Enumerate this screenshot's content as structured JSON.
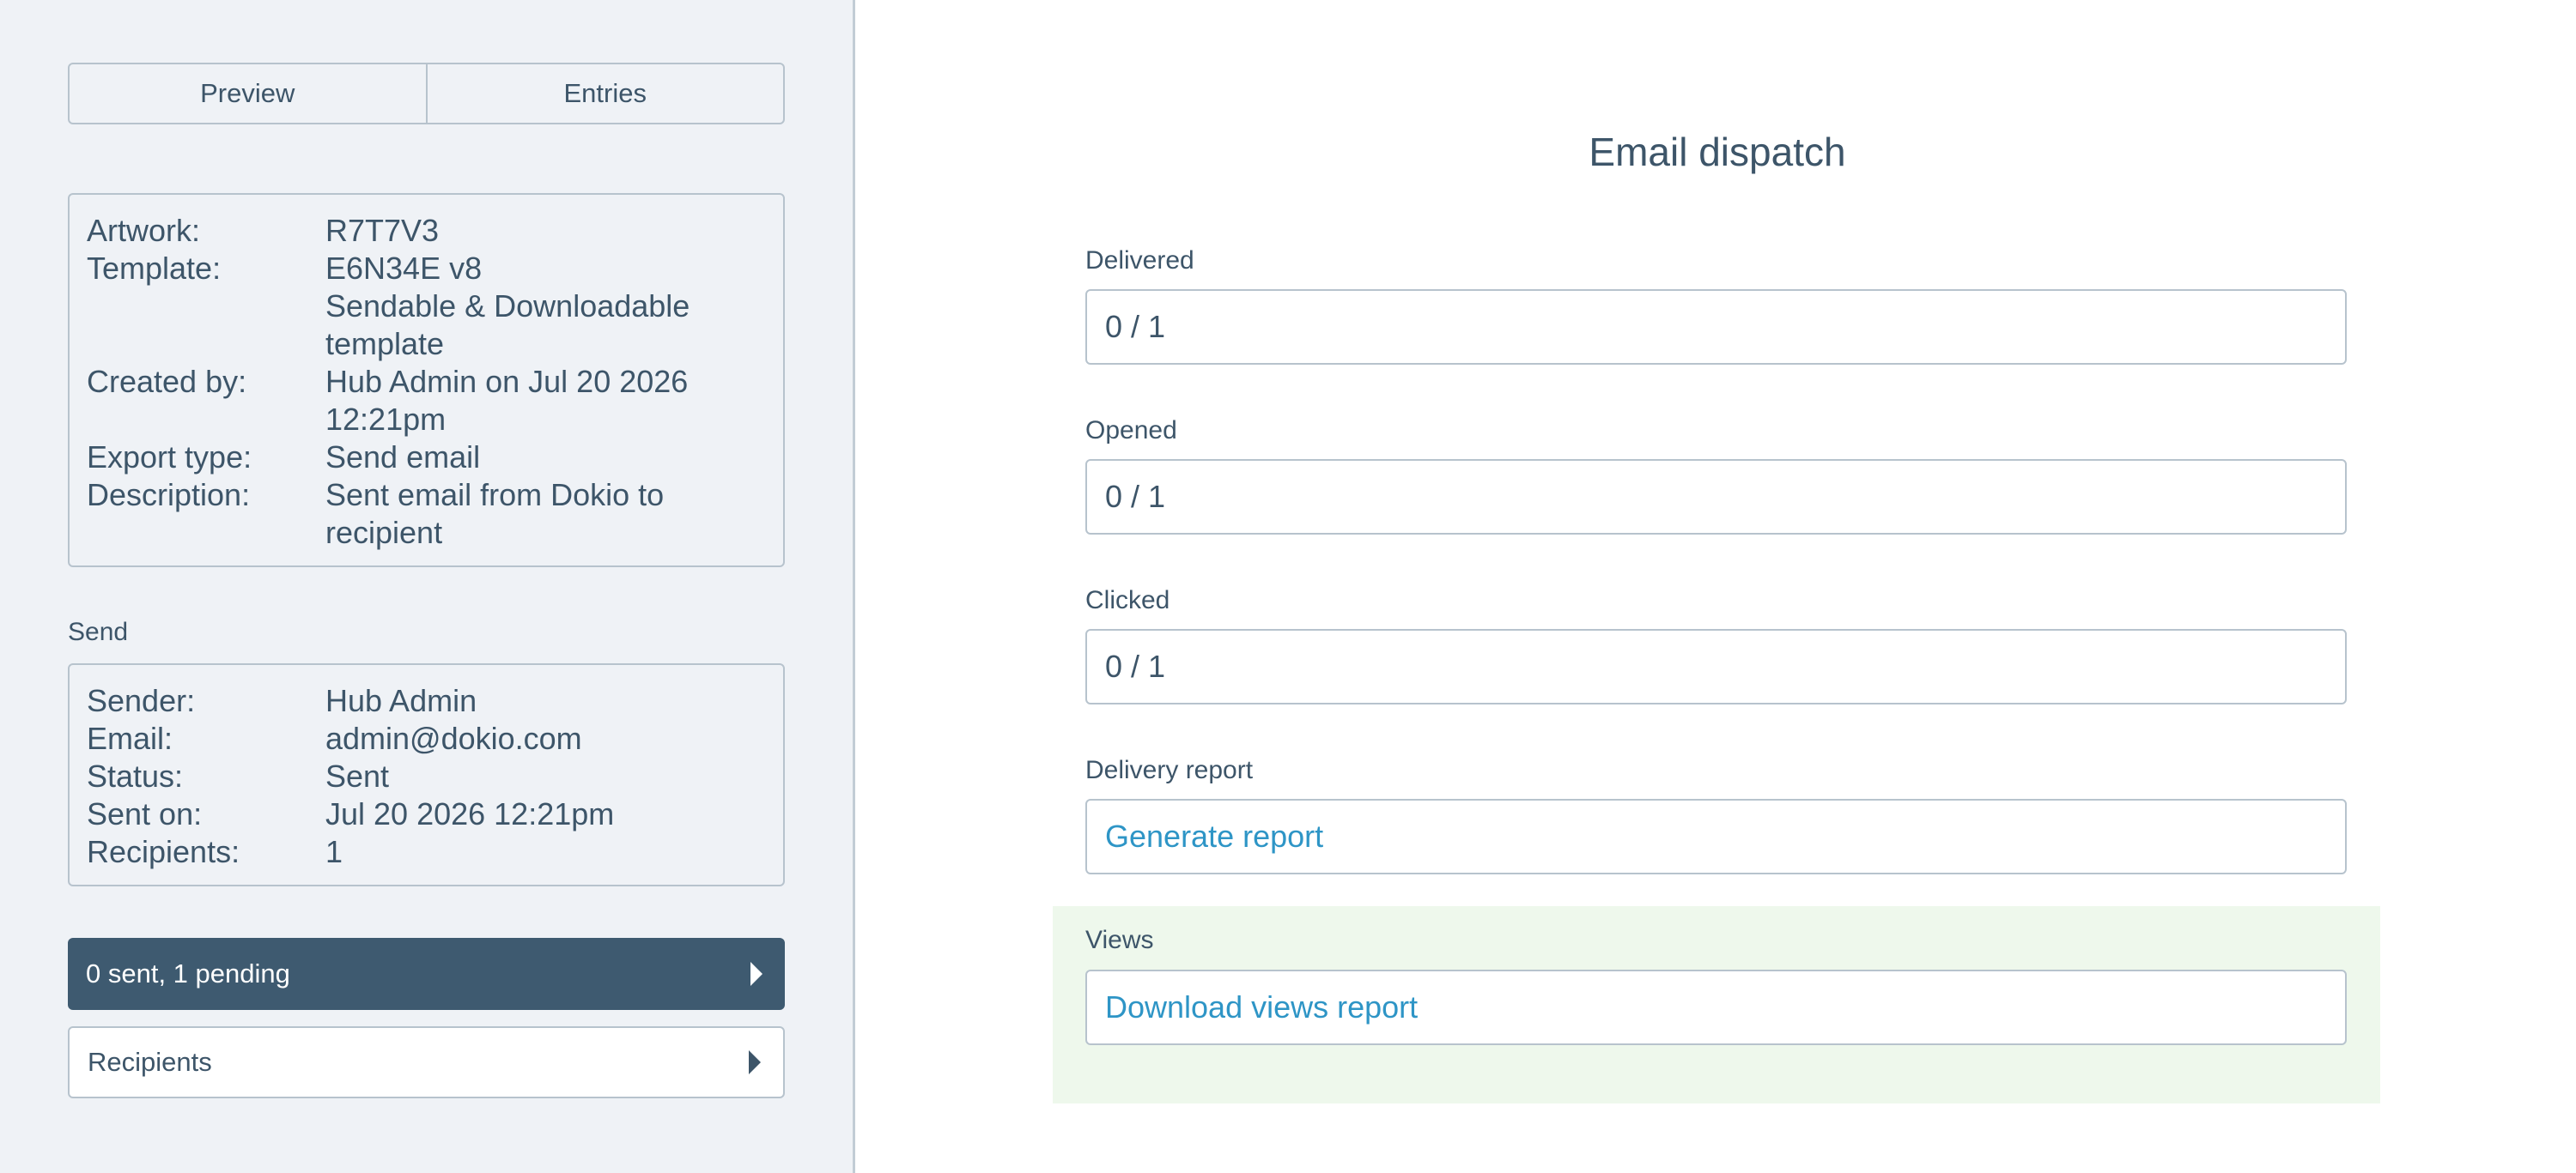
{
  "tabs": {
    "preview": "Preview",
    "entries": "Entries"
  },
  "details": {
    "artwork_label": "Artwork:",
    "artwork": "R7T7V3",
    "template_label": "Template:",
    "template_line1": "E6N34E v8",
    "template_line2": "Sendable & Downloadable template",
    "created_by_label": "Created by:",
    "created_by": "Hub Admin on Jul 20 2026 12:21pm",
    "export_type_label": "Export type:",
    "export_type": "Send email",
    "description_label": "Description:",
    "description": "Sent email from Dokio to recipient"
  },
  "send": {
    "section_title": "Send",
    "sender_label": "Sender:",
    "sender": "Hub Admin",
    "email_label": "Email:",
    "email": "admin@dokio.com",
    "status_label": "Status:",
    "status": "Sent",
    "sent_on_label": "Sent on:",
    "sent_on": "Jul 20 2026 12:21pm",
    "recipients_label": "Recipients:",
    "recipients": "1"
  },
  "progress_bar": {
    "label": "0 sent, 1 pending"
  },
  "recipients_bar": {
    "label": "Recipients"
  },
  "main": {
    "title": "Email dispatch",
    "delivered_label": "Delivered",
    "delivered_value": "0 / 1",
    "opened_label": "Opened",
    "opened_value": "0 / 1",
    "clicked_label": "Clicked",
    "clicked_value": "0 / 1",
    "delivery_report_label": "Delivery report",
    "delivery_report_link": "Generate report",
    "views_label": "Views",
    "views_link": "Download views report"
  },
  "colors": {
    "sidebar_bg": "#eff2f6",
    "dark_bar": "#3e5a70",
    "link": "#2e95c6",
    "highlight_bg": "#eef8ec",
    "text": "#3d5569"
  }
}
